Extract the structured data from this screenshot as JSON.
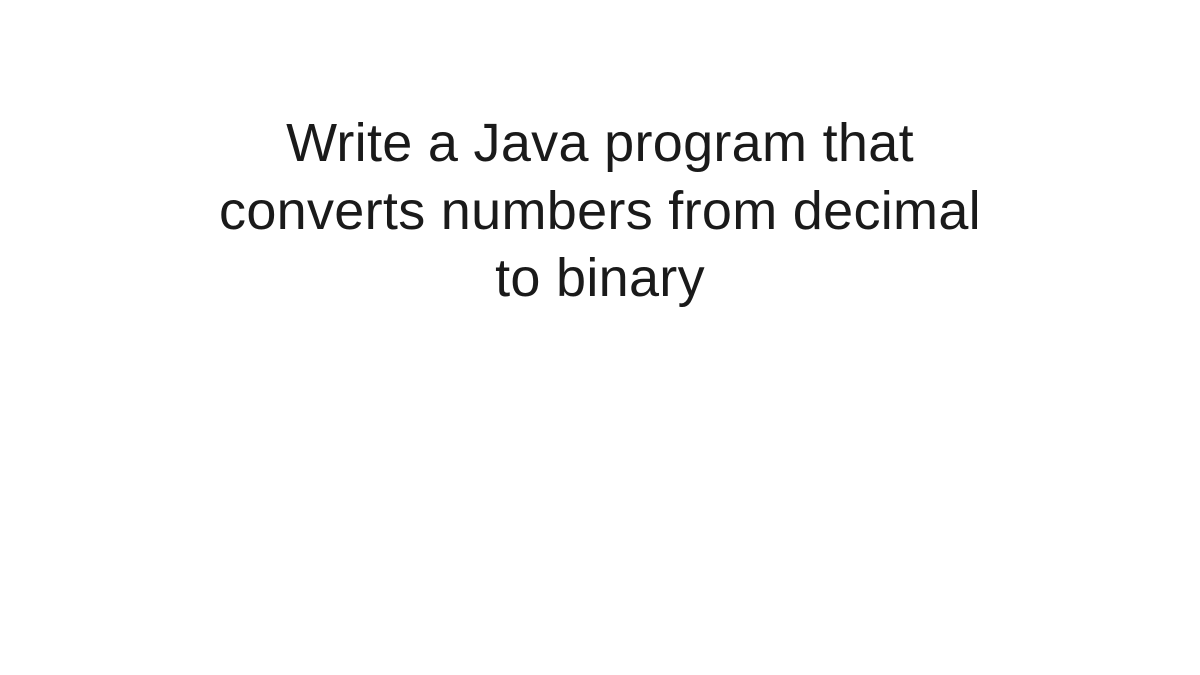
{
  "slide": {
    "line1": "Write a Java program that",
    "line2": "converts numbers from decimal",
    "line3": "to binary"
  }
}
